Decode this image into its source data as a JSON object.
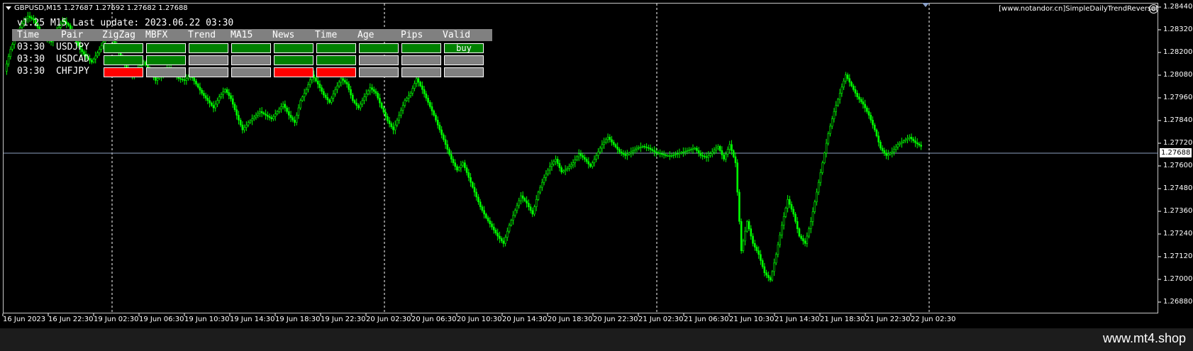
{
  "window": {
    "symbol_title": "GBPUSD,M15  1.27687 1.27692 1.27682 1.27688",
    "brand": "[www.notandor.cn]SimpleDailyTrendReversal",
    "brand_icon": "smiley-icon"
  },
  "indicator": {
    "version_line": "v1.25 M15 Last update: 2023.06.22 03:30",
    "headers": [
      "Time",
      "Pair",
      "ZigZag",
      "MBFX",
      "Trend",
      "MA15",
      "News",
      "Time",
      "Age",
      "Pips",
      "Valid"
    ],
    "rows": [
      {
        "time": "03:30",
        "pair": "USDJPY",
        "cells": [
          "green",
          "green",
          "green",
          "green",
          "green",
          "green",
          "green",
          "green",
          "green"
        ],
        "valid_label": "buy"
      },
      {
        "time": "03:30",
        "pair": "USDCAD",
        "cells": [
          "green",
          "green",
          "gray",
          "gray",
          "green",
          "green",
          "gray",
          "gray",
          "gray"
        ],
        "valid_label": ""
      },
      {
        "time": "03:30",
        "pair": "CHFJPY",
        "cells": [
          "red",
          "gray",
          "gray",
          "gray",
          "red",
          "red",
          "gray",
          "gray",
          "gray"
        ],
        "valid_label": ""
      }
    ],
    "colors": {
      "green": "#008000",
      "red": "#ff0000",
      "gray": "#808080",
      "header": "#808080"
    }
  },
  "price_axis": {
    "labels": [
      "1.28440",
      "1.28320",
      "1.28200",
      "1.28080",
      "1.27960",
      "1.27840",
      "1.27720",
      "1.27600",
      "1.27480",
      "1.27360",
      "1.27240",
      "1.27120",
      "1.27000",
      "1.26880"
    ],
    "current_price": "1.27688"
  },
  "time_axis": {
    "labels": [
      "16 Jun 2023",
      "16 Jun 22:30",
      "19 Jun 02:30",
      "19 Jun 06:30",
      "19 Jun 10:30",
      "19 Jun 14:30",
      "19 Jun 18:30",
      "19 Jun 22:30",
      "20 Jun 02:30",
      "20 Jun 06:30",
      "20 Jun 10:30",
      "20 Jun 14:30",
      "20 Jun 18:30",
      "20 Jun 22:30",
      "21 Jun 02:30",
      "21 Jun 06:30",
      "21 Jun 10:30",
      "21 Jun 14:30",
      "21 Jun 18:30",
      "21 Jun 22:30",
      "22 Jun 02:30"
    ]
  },
  "chart_data": {
    "type": "line",
    "title": "",
    "xlabel": "",
    "ylabel": "",
    "ylim": [
      1.2684,
      1.2845
    ],
    "candle_color": "#00ff00",
    "series": [
      {
        "values": [
          1.281,
          1.2822,
          1.283,
          1.2836,
          1.284,
          1.2838,
          1.2832,
          1.2828,
          1.2826,
          1.2832,
          1.2838,
          1.2835,
          1.2828,
          1.2822,
          1.2818,
          1.2815,
          1.282,
          1.2826,
          1.283,
          1.2825,
          1.2818,
          1.2812,
          1.2808,
          1.2812,
          1.2815,
          1.281,
          1.2805,
          1.2808,
          1.2812,
          1.281,
          1.2806,
          1.2805,
          1.2808,
          1.2803,
          1.2798,
          1.2794,
          1.279,
          1.2796,
          1.28,
          1.2795,
          1.2786,
          1.2778,
          1.2782,
          1.2785,
          1.2788,
          1.2786,
          1.2784,
          1.2788,
          1.2792,
          1.2786,
          1.2782,
          1.2794,
          1.28,
          1.2808,
          1.2803,
          1.2797,
          1.2793,
          1.28,
          1.2806,
          1.2803,
          1.2794,
          1.279,
          1.2796,
          1.2801,
          1.2798,
          1.279,
          1.2783,
          1.2778,
          1.2786,
          1.2794,
          1.2798,
          1.2806,
          1.28,
          1.2793,
          1.2786,
          1.2778,
          1.277,
          1.2762,
          1.2756,
          1.276,
          1.2752,
          1.2744,
          1.2736,
          1.273,
          1.2725,
          1.272,
          1.2716,
          1.2726,
          1.2734,
          1.2742,
          1.2738,
          1.2732,
          1.2744,
          1.2752,
          1.2758,
          1.2762,
          1.2755,
          1.2757,
          1.276,
          1.2765,
          1.2762,
          1.2758,
          1.2764,
          1.277,
          1.2774,
          1.277,
          1.2766,
          1.2764,
          1.2766,
          1.2768,
          1.2769,
          1.2768,
          1.2766,
          1.2765,
          1.2764,
          1.2764,
          1.2765,
          1.2766,
          1.2767,
          1.2768,
          1.2764,
          1.2763,
          1.2766,
          1.2769,
          1.2762,
          1.277,
          1.276,
          1.2712,
          1.2728,
          1.2716,
          1.271,
          1.27,
          1.2696,
          1.271,
          1.2726,
          1.274,
          1.2732,
          1.272,
          1.2716,
          1.2728,
          1.2744,
          1.276,
          1.2776,
          1.2788,
          1.2798,
          1.2808,
          1.2802,
          1.2796,
          1.2792,
          1.2786,
          1.2778,
          1.2768,
          1.2764,
          1.2766,
          1.277,
          1.2772,
          1.2774,
          1.2771,
          1.2769
        ]
      }
    ]
  },
  "footer": {
    "site": "www.mt4.shop"
  }
}
